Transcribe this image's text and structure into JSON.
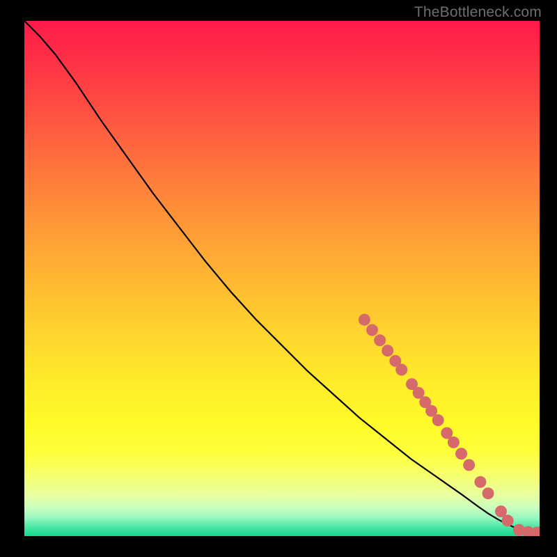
{
  "watermark": "TheBottleneck.com",
  "colors": {
    "line": "#000000",
    "marker_fill": "#d66a6a",
    "marker_stroke": "#b85050",
    "background_black": "#000000"
  },
  "chart_data": {
    "type": "line",
    "title": "",
    "xlabel": "",
    "ylabel": "",
    "xlim": [
      0,
      100
    ],
    "ylim": [
      0,
      100
    ],
    "grid": false,
    "series": [
      {
        "name": "curve",
        "x": [
          0,
          3,
          6,
          10,
          15,
          20,
          25,
          30,
          35,
          40,
          45,
          50,
          55,
          60,
          65,
          70,
          75,
          80,
          85,
          88,
          90,
          92,
          94,
          96,
          98,
          100
        ],
        "y": [
          100,
          97,
          93.5,
          88,
          80.5,
          73.5,
          66.5,
          60,
          53.5,
          47.5,
          42,
          37,
          32,
          27.5,
          23,
          19,
          15,
          11.5,
          8,
          5.8,
          4.4,
          3.2,
          2.2,
          1.3,
          0.6,
          0.4
        ]
      }
    ],
    "markers": [
      {
        "x": 66,
        "y": 42
      },
      {
        "x": 67.5,
        "y": 40
      },
      {
        "x": 69,
        "y": 38
      },
      {
        "x": 70.5,
        "y": 36
      },
      {
        "x": 72,
        "y": 34
      },
      {
        "x": 73.2,
        "y": 32.3
      },
      {
        "x": 75.2,
        "y": 29.5
      },
      {
        "x": 76.5,
        "y": 27.8
      },
      {
        "x": 77.8,
        "y": 26
      },
      {
        "x": 79,
        "y": 24.3
      },
      {
        "x": 80.3,
        "y": 22.5
      },
      {
        "x": 82,
        "y": 20
      },
      {
        "x": 83.3,
        "y": 18.2
      },
      {
        "x": 84.8,
        "y": 16
      },
      {
        "x": 86.3,
        "y": 13.8
      },
      {
        "x": 88.5,
        "y": 10.5
      },
      {
        "x": 90,
        "y": 8.3
      },
      {
        "x": 92.5,
        "y": 4.8
      },
      {
        "x": 93.8,
        "y": 3
      },
      {
        "x": 96,
        "y": 1.2
      },
      {
        "x": 97.8,
        "y": 0.8
      },
      {
        "x": 99.5,
        "y": 0.7
      }
    ]
  }
}
